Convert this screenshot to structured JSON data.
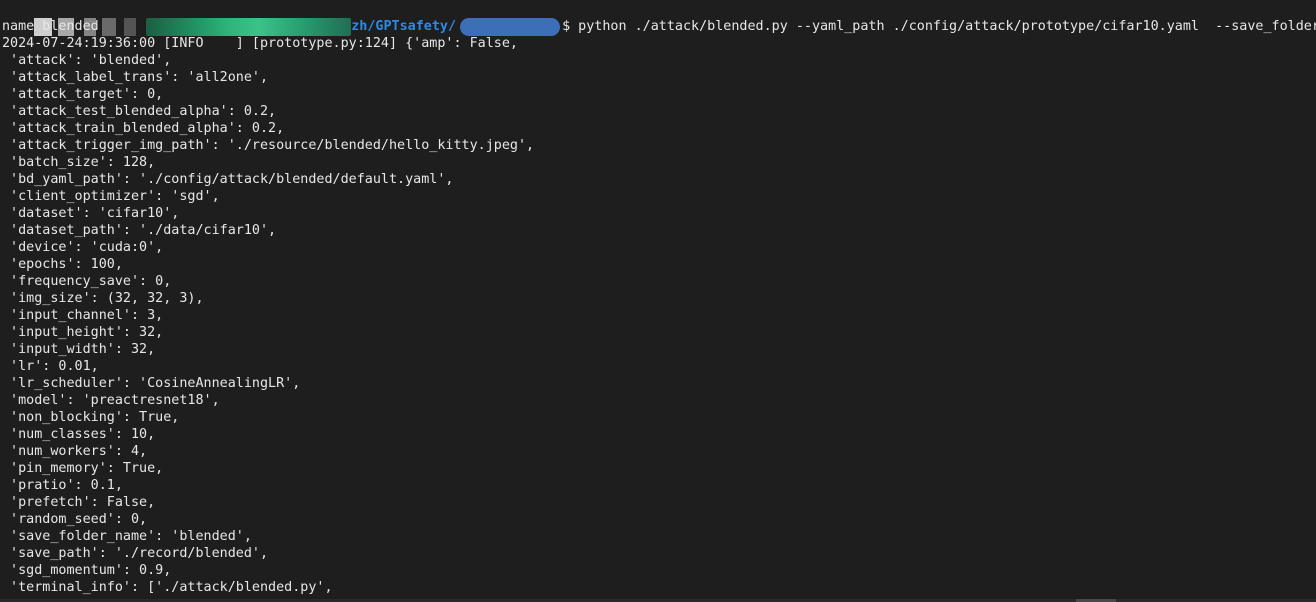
{
  "terminal": {
    "prompt_path": "zh/GPTsafety/",
    "command": "$ python ./attack/blended.py --yaml_path ./config/attack/prototype/cifar10.yaml  --save_folder_",
    "lines": [
      "name blended",
      "2024-07-24:19:36:00 [INFO    ] [prototype.py:124] {'amp': False,",
      " 'attack': 'blended',",
      " 'attack_label_trans': 'all2one',",
      " 'attack_target': 0,",
      " 'attack_test_blended_alpha': 0.2,",
      " 'attack_train_blended_alpha': 0.2,",
      " 'attack_trigger_img_path': './resource/blended/hello_kitty.jpeg',",
      " 'batch_size': 128,",
      " 'bd_yaml_path': './config/attack/blended/default.yaml',",
      " 'client_optimizer': 'sgd',",
      " 'dataset': 'cifar10',",
      " 'dataset_path': './data/cifar10',",
      " 'device': 'cuda:0',",
      " 'epochs': 100,",
      " 'frequency_save': 0,",
      " 'img_size': (32, 32, 3),",
      " 'input_channel': 3,",
      " 'input_height': 32,",
      " 'input_width': 32,",
      " 'lr': 0.01,",
      " 'lr_scheduler': 'CosineAnnealingLR',",
      " 'model': 'preactresnet18',",
      " 'non_blocking': True,",
      " 'num_classes': 10,",
      " 'num_workers': 4,",
      " 'pin_memory': True,",
      " 'pratio': 0.1,",
      " 'prefetch': False,",
      " 'random_seed': 0,",
      " 'save_folder_name': 'blended',",
      " 'save_path': './record/blended',",
      " 'sgd_momentum': 0.9,",
      " 'terminal_info': ['./attack/blended.py',"
    ]
  },
  "colors": {
    "background": "#1e1e1e",
    "text": "#e7e7e7",
    "path": "#2b8be6"
  }
}
